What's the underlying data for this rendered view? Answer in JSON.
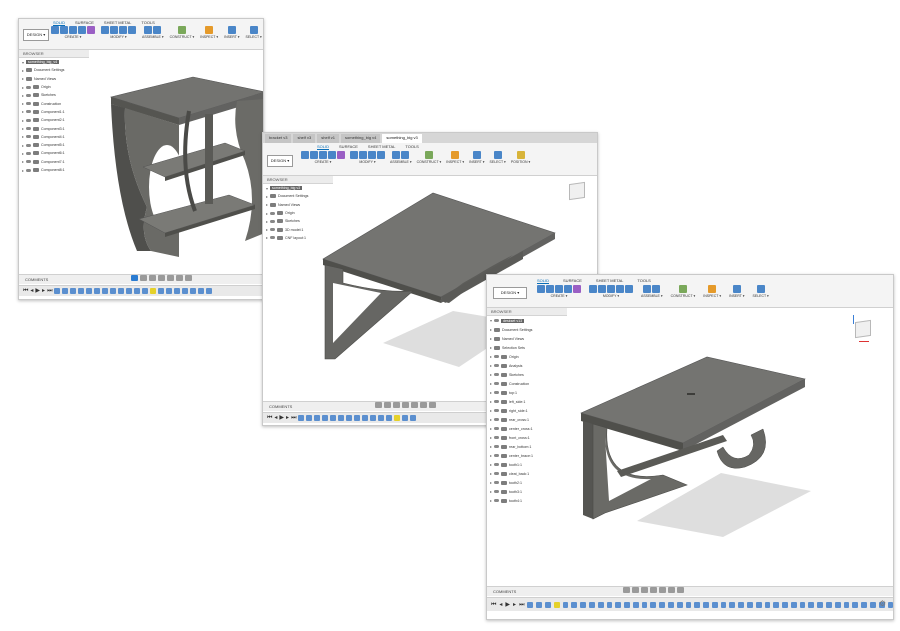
{
  "window1": {
    "ribbon_tabs": [
      "SOLID",
      "SURFACE",
      "SHEET METAL",
      "TOOLS"
    ],
    "design_button": "DESIGN ▾",
    "groups": [
      "CREATE ▾",
      "MODIFY ▾",
      "ASSEMBLE ▾",
      "CONSTRUCT ▾",
      "INSPECT ▾",
      "INSERT ▾",
      "SELECT ▾"
    ],
    "browser_title": "BROWSER",
    "root": "something_big_v4",
    "items": [
      "Document Settings",
      "Named Views",
      "Origin",
      "Sketches",
      "Construction",
      "Component1:1",
      "Component2:1",
      "Component3:1",
      "Component4:1",
      "Component5:1",
      "Component6:1",
      "Component7:1",
      "Component8:1"
    ],
    "comments": "COMMENTS"
  },
  "window2": {
    "doc_tabs": [
      "bracket v3",
      "shelf v3",
      "shelf v1",
      "something_big v4",
      "something_big v3"
    ],
    "ribbon_tabs": [
      "SOLID",
      "SURFACE",
      "SHEET METAL",
      "TOOLS"
    ],
    "design_button": "DESIGN ▾",
    "groups": [
      "CREATE ▾",
      "MODIFY ▾",
      "ASSEMBLE ▾",
      "CONSTRUCT ▾",
      "INSPECT ▾",
      "INSERT ▾",
      "SELECT ▾",
      "POSITION ▾"
    ],
    "browser_title": "BROWSER",
    "root": "something_big v3",
    "items": [
      "Document Settings",
      "Named Views",
      "Origin",
      "Sketches",
      "3D model:1",
      "CNF layout:1"
    ],
    "comments": "COMMENTS"
  },
  "window3": {
    "ribbon_tabs": [
      "SOLID",
      "SURFACE",
      "SHEET METAL",
      "TOOLS"
    ],
    "design_button": "DESIGN ▾",
    "groups": [
      "CREATE ▾",
      "MODIFY ▾",
      "ASSEMBLE ▾",
      "CONSTRUCT ▾",
      "INSPECT ▾",
      "INSERT ▾",
      "SELECT ▾"
    ],
    "browser_title": "BROWSER",
    "root": "deskset v13",
    "items": [
      "Document Settings",
      "Named Views",
      "Selection Sets",
      "Origin",
      "Analysis",
      "Sketches",
      "Construction",
      "top:1",
      "left_side:1",
      "right_side:1",
      "rear_cross:1",
      "center_cross:1",
      "front_cross:1",
      "rear_bottom:1",
      "center_brace:1",
      "tooth1:1",
      "cleat_back:1",
      "tooth2:1",
      "tooth3:1",
      "tooth4:1"
    ],
    "comments": "COMMENTS"
  },
  "colors": {
    "model": "#6f6f6a",
    "model_light": "#8a8a84",
    "model_dark": "#4e4e4a",
    "accent": "#0a6fb8",
    "shadow": "#dcdcdc"
  }
}
